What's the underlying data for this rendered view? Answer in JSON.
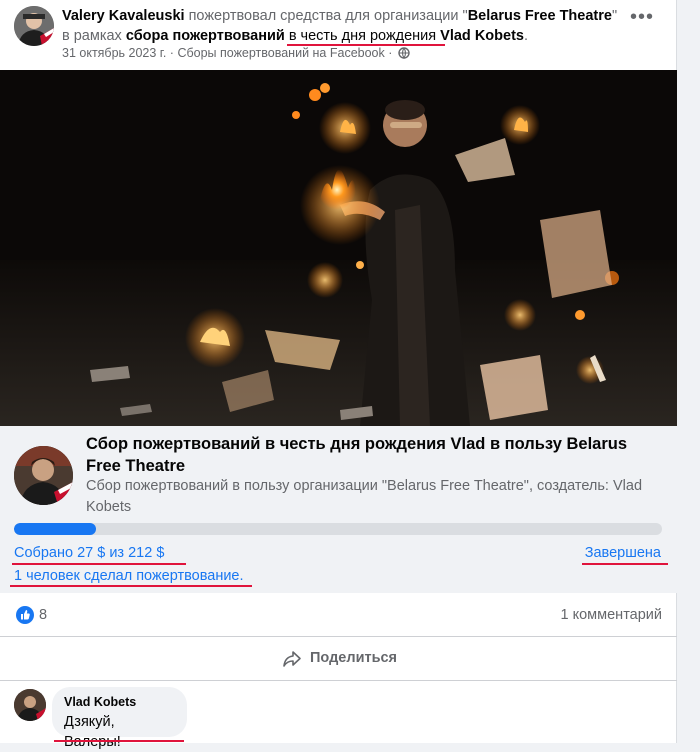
{
  "header": {
    "author": "Valery Kavaleuski",
    "action_text": " пожертвовал средства для организации \"",
    "organization": "Belarus Free Theatre",
    "action_text2": "\" в рамках ",
    "fundraiser_link": "сбора пожертвований",
    "space": " ",
    "occasion": "в честь дня рождения",
    "space2": " ",
    "honoree": "Vlad Kobets",
    "period": ".",
    "date": "31 октябрь 2023 г.",
    "separator": " · ",
    "source": "Сборы пожертвований на Facebook",
    "separator2": " · ",
    "privacy_icon": "globe-icon",
    "more_label": "•••"
  },
  "fundraiser": {
    "title": "Сбор пожертвований в честь дня рождения Vlad в пользу Belarus Free Theatre",
    "subtitle": "Сбор пожертвований в пользу организации \"Belarus Free Theatre\", создатель: Vlad Kobets",
    "raised_text": "Собрано 27 $ из 212 $",
    "progress_fraction": 0.127,
    "status": "Завершена",
    "donors_text": "1 человек сделал пожертвование."
  },
  "reactions": {
    "icon": "like-icon",
    "count": "8",
    "comments": "1 комментарий"
  },
  "actions": {
    "share_icon": "share-icon",
    "share_label": "Поделиться"
  },
  "comment": {
    "author": "Vlad Kobets",
    "text": "Дзякуй, Валеры!"
  },
  "colors": {
    "accent": "#1877f2",
    "underline": "#e0143c",
    "secondary_text": "#65676b"
  }
}
